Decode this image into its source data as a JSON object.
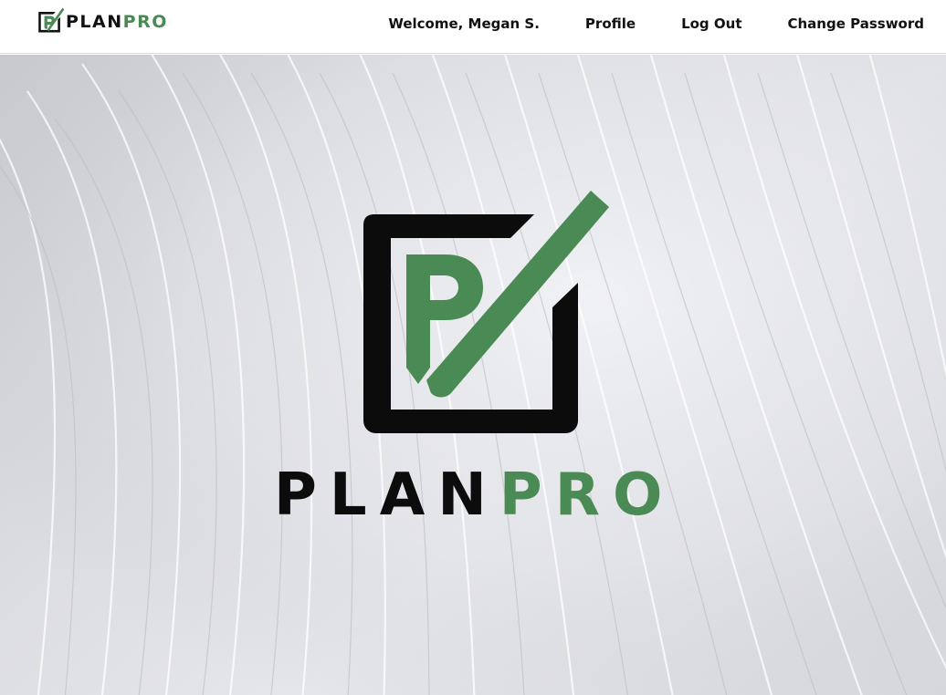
{
  "brand": {
    "name_part1": "PLAN",
    "name_part2": "PRO",
    "icon": "checkbox-p-logo-icon",
    "colors": {
      "dark": "#111111",
      "green": "#4a8a54"
    }
  },
  "nav": {
    "welcome": "Welcome, Megan S.",
    "profile": "Profile",
    "logout": "Log Out",
    "change_password": "Change Password"
  },
  "hero": {
    "wordmark_part1": "PLAN",
    "wordmark_part2": "PRO",
    "logo_icon": "checkbox-p-logo-icon",
    "background": "abstract-wave-lines"
  }
}
